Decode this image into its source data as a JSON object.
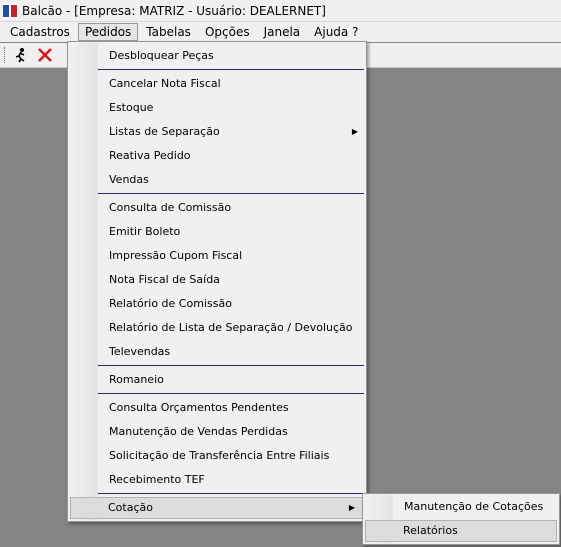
{
  "window": {
    "title": "Balcão - [Empresa: MATRIZ - Usuário: DEALERNET]"
  },
  "menubar": {
    "items": [
      "Cadastros",
      "Pedidos",
      "Tabelas",
      "Opções",
      "Janela",
      "Ajuda ?"
    ]
  },
  "toolbar": {
    "icons": [
      "exit-runner-icon",
      "close-x-icon"
    ]
  },
  "pedidos_menu": {
    "items": [
      "Desbloquear Peças",
      "Cancelar Nota Fiscal",
      "Estoque",
      "Listas de Separação",
      "Reativa Pedido",
      "Vendas",
      "Consulta de Comissão",
      "Emitir Boleto",
      "Impressão Cupom Fiscal",
      "Nota Fiscal de Saída",
      "Relatório de Comissão",
      "Relatório de Lista de Separação / Devolução",
      "Televendas",
      "Romaneio",
      "Consulta Orçamentos Pendentes",
      "Manutenção de Vendas Perdidas",
      "Solicitação de Transferência Entre Filiais",
      "Recebimento TEF",
      "Cotação"
    ]
  },
  "cotacao_submenu": {
    "items": [
      "Manutenção de Cotações",
      "Relatórios"
    ]
  },
  "colors": {
    "workspace": "#848484",
    "menu_bg": "#f0f0f0",
    "separator": "#2a2a6a"
  }
}
